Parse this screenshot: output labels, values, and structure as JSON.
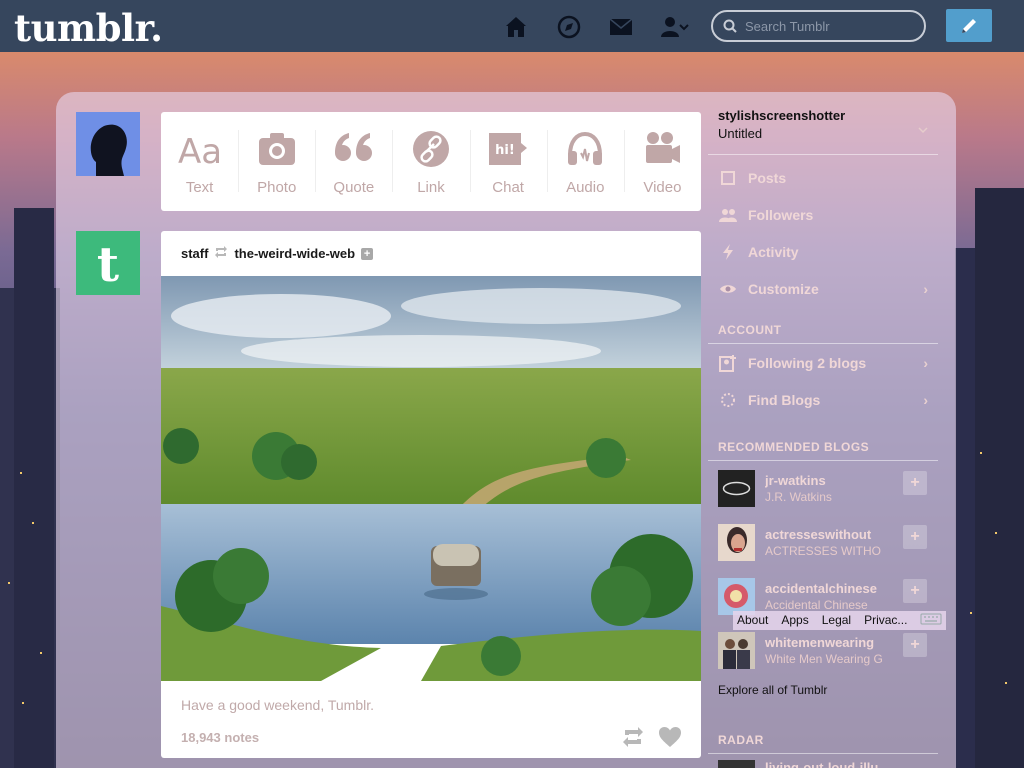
{
  "header": {
    "logo": "tumblr.",
    "search_placeholder": "Search Tumblr",
    "nav_icons": [
      "home-icon",
      "compass-icon",
      "mail-icon",
      "account-icon"
    ],
    "compose_icon": "pencil-icon",
    "colors": {
      "bar": "#36465d",
      "compose": "#529ecc"
    }
  },
  "post_types": [
    {
      "label": "Text",
      "icon": "text-icon"
    },
    {
      "label": "Photo",
      "icon": "camera-icon"
    },
    {
      "label": "Quote",
      "icon": "quote-icon"
    },
    {
      "label": "Link",
      "icon": "link-icon"
    },
    {
      "label": "Chat",
      "icon": "chat-icon"
    },
    {
      "label": "Audio",
      "icon": "headphones-icon"
    },
    {
      "label": "Video",
      "icon": "video-camera-icon"
    }
  ],
  "post": {
    "author": "staff",
    "reblogged_from": "the-weird-wide-web",
    "caption": "Have a good weekend, Tumblr.",
    "notes": "18,943 notes"
  },
  "sidebar": {
    "blog_name": "stylishscreenshotter",
    "blog_title": "Untitled",
    "items": [
      {
        "label": "Posts",
        "icon": "posts-icon"
      },
      {
        "label": "Followers",
        "icon": "followers-icon"
      },
      {
        "label": "Activity",
        "icon": "activity-icon"
      },
      {
        "label": "Customize",
        "icon": "eye-icon"
      }
    ],
    "account_heading": "ACCOUNT",
    "account_items": [
      {
        "label": "Following 2 blogs",
        "icon": "following-icon"
      },
      {
        "label": "Find Blogs",
        "icon": "find-icon"
      }
    ],
    "recommended_heading": "RECOMMENDED BLOGS",
    "recommended": [
      {
        "name": "jr-watkins",
        "sub": "J.R. Watkins"
      },
      {
        "name": "actresseswithout",
        "sub": "ACTRESSES WITHO"
      },
      {
        "name": "accidentalchinese",
        "sub": "Accidental Chinese"
      },
      {
        "name": "whitemenwearing",
        "sub": "White Men Wearing G"
      }
    ],
    "explore": "Explore all of Tumblr",
    "radar_heading": "RADAR",
    "radar_partial": "living-out-loud-illu"
  },
  "footer_links": [
    "About",
    "Apps",
    "Legal",
    "Privac..."
  ]
}
